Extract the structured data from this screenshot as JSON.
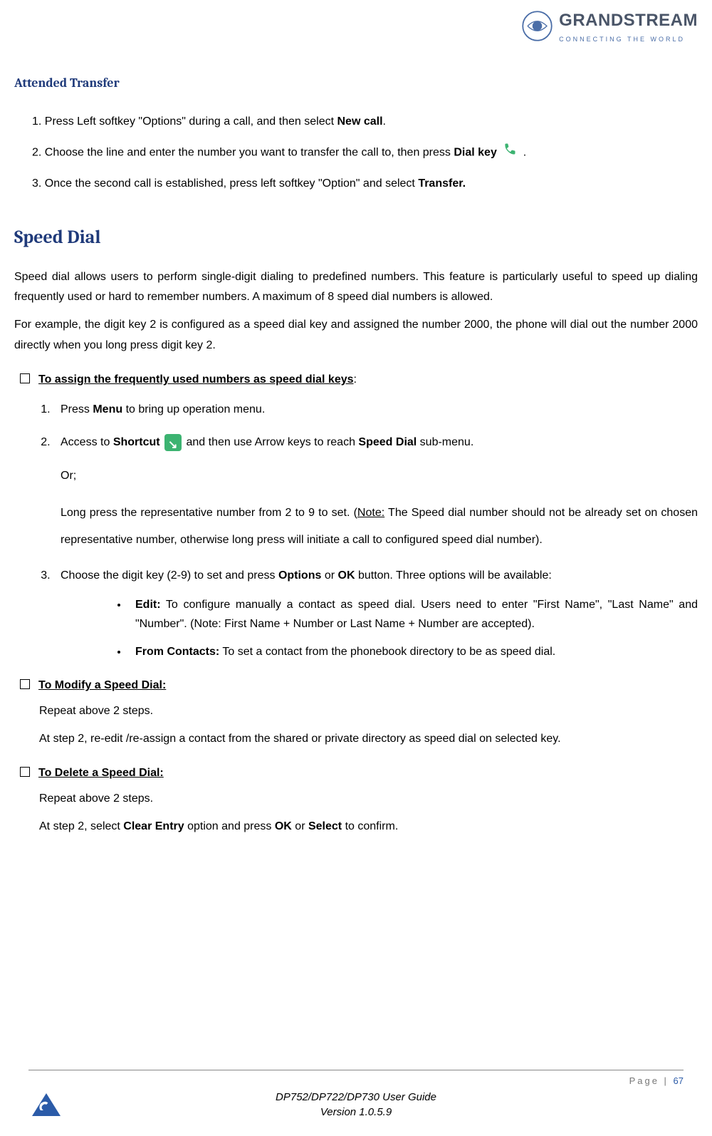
{
  "header": {
    "brand": "GRANDSTREAM",
    "tagline": "CONNECTING THE WORLD"
  },
  "attended": {
    "title": "Attended Transfer",
    "steps": {
      "s1a": "1. Press Left softkey \"Options\" during a call, and then select ",
      "s1b": "New call",
      "s1c": ".",
      "s2a": "2. Choose the line and enter the number you want to transfer the call to, then press ",
      "s2b": "Dial key",
      "s2c": " .",
      "s3a": "3. Once the second call is established, press left softkey \"Option\" and select ",
      "s3b": "Transfer."
    }
  },
  "speed": {
    "title": "Speed Dial",
    "intro1": "Speed dial allows users to perform single-digit dialing to predefined numbers. This feature is particularly useful to speed up dialing frequently used or hard to remember numbers. A maximum of 8 speed dial numbers is allowed.",
    "intro2": "For example, the digit key 2 is configured as a speed dial key and assigned the number 2000, the phone will dial out the number 2000 directly when you long press digit key 2.",
    "assign": {
      "header": "To assign the frequently used numbers as speed dial keys",
      "colon": ":",
      "i1a": "Press ",
      "i1b": "Menu",
      "i1c": " to bring up operation menu.",
      "i2a": "Access to ",
      "i2b": "Shortcut",
      "i2c": " and then use Arrow keys to reach ",
      "i2d": "Speed Dial",
      "i2e": " sub-menu.",
      "i2or": "Or;",
      "i2long_a": "Long press the representative number from 2 to 9 to set. (",
      "i2long_note": "Note:",
      "i2long_b": " The Speed dial number should not be already set on chosen representative number, otherwise long press will initiate a call to configured speed dial number).",
      "i3a": "Choose the digit key (2-9) to set and press ",
      "i3b": "Options",
      "i3c": " or ",
      "i3d": "OK",
      "i3e": " button. Three options will be available:",
      "opt1a": "Edit:",
      "opt1b": " To configure manually a contact as speed dial. Users need to enter \"First Name\", \"Last Name\" and \"Number\". (Note: First Name + Number or Last Name + Number are accepted).",
      "opt2a": "From Contacts:",
      "opt2b": " To set a contact from the phonebook directory to be as speed dial."
    },
    "modify": {
      "header": "To Modify a Speed Dial:",
      "l1": "Repeat above 2 steps.",
      "l2": "At step 2, re-edit /re-assign a contact from the shared or private directory as speed dial on selected key."
    },
    "delete": {
      "header": "To Delete a Speed Dial:",
      "l1": "Repeat above 2 steps.",
      "l2a": "At step 2, select ",
      "l2b": "Clear Entry",
      "l2c": " option and press ",
      "l2d": "OK",
      "l2e": " or ",
      "l2f": "Select",
      "l2g": " to confirm."
    }
  },
  "footer": {
    "doc_title": "DP752/DP722/DP730 User Guide",
    "version": "Version 1.0.5.9",
    "page_label": "Page | ",
    "page_num": "67"
  }
}
